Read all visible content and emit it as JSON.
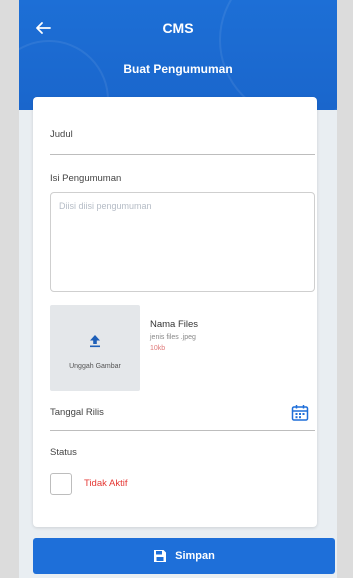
{
  "header": {
    "app_title": "CMS",
    "page_title": "Buat Pengumuman",
    "back_icon": "arrow-left-icon"
  },
  "form": {
    "judul_label": "Judul",
    "isi_label": "Isi Pengumuman",
    "isi_placeholder": "Diisi diisi pengumuman",
    "upload_label": "Unggah Gambar",
    "file_name": "Nama Files",
    "file_type": "jenis files .jpeg",
    "file_size": "10kb",
    "tanggal_label": "Tanggal Rilis",
    "status_label": "Status",
    "status_value": "Tidak Aktif"
  },
  "footer": {
    "save_label": "Simpan"
  },
  "colors": {
    "primary": "#1e6fd9",
    "danger": "#e53935"
  }
}
